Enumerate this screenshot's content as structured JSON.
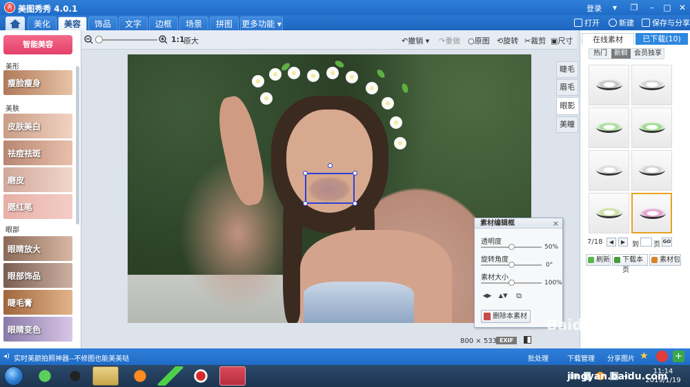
{
  "app": {
    "title": "美图秀秀 4.0.1",
    "login": "登录",
    "logo_text": "秀"
  },
  "menu": {
    "tabs": [
      "美化",
      "美容",
      "饰品",
      "文字",
      "边框",
      "场景",
      "拼图",
      "更多功能"
    ],
    "active": "美容",
    "actions": {
      "open": "打开",
      "new": "新建",
      "save_share": "保存与分享"
    }
  },
  "toolbar": {
    "ratio_label": "1:1",
    "original_size": "原大",
    "undo": "撤销",
    "redo": "重做",
    "original": "原图",
    "rotate": "旋转",
    "crop": "裁剪",
    "resize": "尺寸"
  },
  "left_panel": {
    "smart_button": "智能美容",
    "sections": [
      {
        "label": "美形",
        "items": [
          "瘦脸瘦身"
        ]
      },
      {
        "label": "美肤",
        "items": [
          "皮肤美白",
          "祛痘祛斑",
          "磨皮",
          "腮红笔"
        ]
      },
      {
        "label": "眼部",
        "items": [
          "眼睛放大",
          "眼部饰品",
          "睫毛膏",
          "眼睛变色"
        ]
      }
    ]
  },
  "canvas": {
    "image_width": "800",
    "image_height": "533",
    "size_sep": "×",
    "exif": "EXIF"
  },
  "side_tabs": [
    "睫毛",
    "眉毛",
    "眼影",
    "美瞳"
  ],
  "side_tab_active": "眼影",
  "material_editor": {
    "title": "素材编辑框",
    "close": "×",
    "opacity_label": "透明度",
    "opacity_value": "50%",
    "opacity_fraction": 0.5,
    "rotation_label": "旋转角度",
    "rotation_value": "0°",
    "rotation_fraction": 0.5,
    "size_label": "素材大小",
    "size_value": "100%",
    "size_fraction": 0.5,
    "delete_button": "删除本素材"
  },
  "right_panel": {
    "tab_online": "在线素材",
    "tab_downloaded": "已下载(10)",
    "sub_tabs": [
      "热门",
      "新鲜",
      "会员独享"
    ],
    "sub_tab_active": "新鲜",
    "thumbnails": [
      {
        "color": "#bdbdbd"
      },
      {
        "color": "#cfcfcf"
      },
      {
        "color": "#9fd98a"
      },
      {
        "color": "#8ed57b"
      },
      {
        "color": "#d9d9d9"
      },
      {
        "color": "#d0d0d0"
      },
      {
        "color": "#c8d99a"
      },
      {
        "color": "#e090c8"
      }
    ],
    "selected_index": 7,
    "page_counter": "7/18",
    "goto_label": "到",
    "page_label": "页",
    "go_button": "GO",
    "refresh": "刷新",
    "download_page": "下载本页",
    "material_pack": "素材包"
  },
  "status_bar": {
    "text": "实时美颜拍照神器--不修图也能美美哒",
    "batch": "批处理",
    "download_manager": "下载管理",
    "share_image": "分享图片"
  },
  "taskbar": {
    "time": "11:14",
    "date": "2019/1/19"
  },
  "watermark": "Baidu 经验",
  "watermark_url": "jingyan.baidu.com",
  "colors": {
    "accent_blue": "#2a78d2",
    "smart_pink": "#e34069",
    "selection_blue": "#2b3fd6",
    "selected_thumb": "#e7a11c"
  }
}
